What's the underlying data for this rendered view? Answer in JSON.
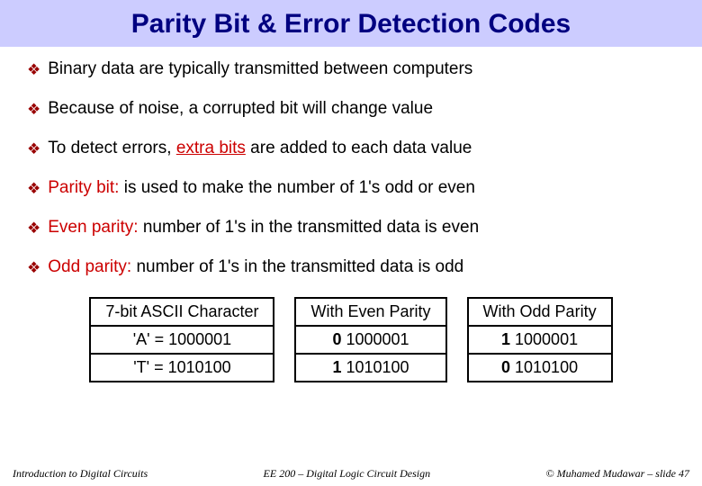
{
  "title": "Parity Bit & Error Detection Codes",
  "bullets": [
    {
      "pre": "",
      "red": "",
      "post": "Binary data are typically transmitted between computers",
      "ul": false
    },
    {
      "pre": "",
      "red": "",
      "post": "Because of noise, a corrupted bit will change value",
      "ul": false
    },
    {
      "pre": "To detect errors, ",
      "red": "extra bits",
      "post": " are added to each data value",
      "ul": true
    },
    {
      "pre": "",
      "red": "Parity bit:",
      "post": " is used to make the number of 1's odd or even",
      "ul": false
    },
    {
      "pre": "",
      "red": "Even parity:",
      "post": " number of 1's in the transmitted data is even",
      "ul": false
    },
    {
      "pre": "",
      "red": "Odd parity:",
      "post": " number of 1's in the transmitted data is odd",
      "ul": false
    }
  ],
  "table1": {
    "h": "7-bit ASCII Character",
    "r1": "'A' = 1000001",
    "r2": "'T' = 1010100"
  },
  "table2": {
    "h": "With Even Parity",
    "r1_b": "0",
    "r1_v": " 1000001",
    "r2_b": "1",
    "r2_v": " 1010100"
  },
  "table3": {
    "h": "With Odd Parity",
    "r1_b": "1",
    "r1_v": " 1000001",
    "r2_b": "0",
    "r2_v": " 1010100"
  },
  "footer": {
    "left": "Introduction to Digital Circuits",
    "center": "EE 200 – Digital Logic Circuit Design",
    "right": "© Muhamed Mudawar – slide 47"
  }
}
